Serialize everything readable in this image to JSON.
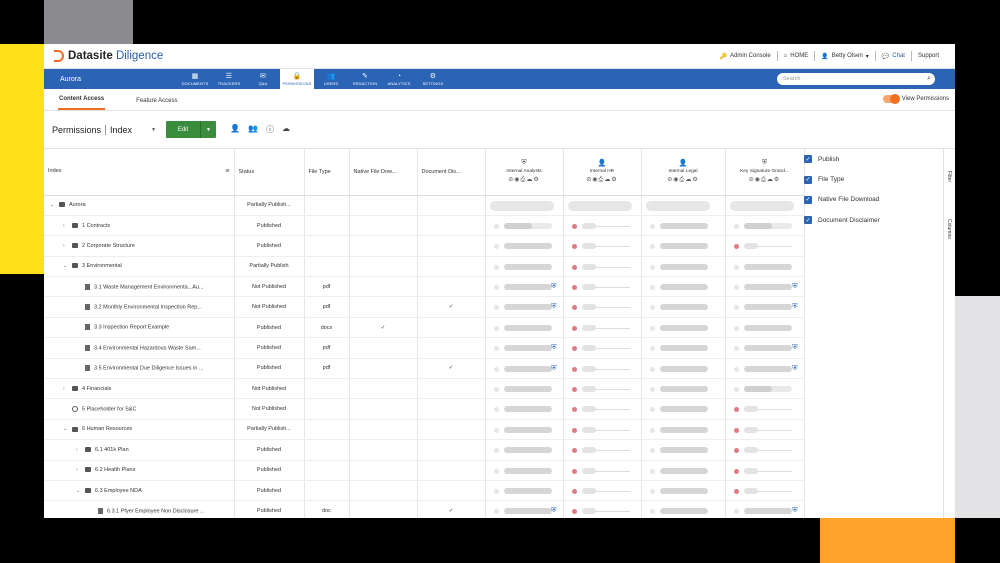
{
  "colors": {
    "brand_orange": "#f26e21",
    "nav_blue": "#2b63b5",
    "edit_green": "#3b8d3e",
    "deny_red": "#e07a83"
  },
  "header": {
    "logo_strong": "Datasite",
    "logo_light": " Diligence",
    "links": {
      "admin": "Admin Console",
      "home": "HOME",
      "user": "Betty Olsen",
      "chat": "Chat",
      "support": "Support"
    }
  },
  "nav": {
    "project": "Aurora",
    "items": [
      {
        "icon": "▦",
        "label": "DOCUMENTS"
      },
      {
        "icon": "☰",
        "label": "TRACKERS"
      },
      {
        "icon": "✉",
        "label": "Q&A"
      },
      {
        "icon": "🔒",
        "label": "PERMISSIONS"
      },
      {
        "icon": "👥",
        "label": "USERS"
      },
      {
        "icon": "✎",
        "label": "REDACTION"
      },
      {
        "icon": "◔",
        "label": "ANALYTICS"
      },
      {
        "icon": "⚙",
        "label": "SETTINGS"
      }
    ],
    "search_placeholder": "Search"
  },
  "subtabs": {
    "content_access": "Content Access",
    "feature_access": "Feature Access",
    "view_permissions": "View Permissions"
  },
  "toolbar": {
    "title": "Permissions",
    "select_value": "Index",
    "edit_label": "Edit"
  },
  "columns": {
    "index": "Index",
    "status": "Status",
    "file_type": "File Type",
    "native_download": "Native File Dow...",
    "doc_disclaimer": "Document Dis...",
    "groups": [
      {
        "icon": "⛨",
        "name": "Internal Analysts",
        "perms": "⊘◉⎙☁⚙"
      },
      {
        "icon": "👤",
        "name": "Internal HR",
        "perms": "⊘◉⎙☁⚙"
      },
      {
        "icon": "👤",
        "name": "Internal Legal",
        "perms": "⊘◉⎙☁⚙"
      },
      {
        "icon": "⛨",
        "name": "Key Signature Grand...",
        "perms": "⊘◉⎙☁⚙"
      }
    ]
  },
  "rows": [
    {
      "indent": 0,
      "toggle": "⌄",
      "kind": "folder",
      "name": "Aurora",
      "status": "Partially Publish...",
      "type": "",
      "native": "",
      "disc": "",
      "perms": [
        "sel",
        "sel_red",
        "sel",
        "sel"
      ],
      "shield": [
        false,
        false,
        false,
        false
      ]
    },
    {
      "indent": 1,
      "toggle": "›",
      "kind": "folder",
      "name": "1 Contracts",
      "status": "Published",
      "type": "",
      "native": "",
      "disc": "",
      "perms": [
        "part",
        "red_line",
        "full",
        "part"
      ],
      "shield": [
        false,
        false,
        false,
        false
      ]
    },
    {
      "indent": 1,
      "toggle": "›",
      "kind": "folder",
      "name": "2 Corporate Structure",
      "status": "Published",
      "type": "",
      "native": "",
      "disc": "",
      "perms": [
        "full",
        "red_line",
        "full",
        "red_line"
      ],
      "shield": [
        false,
        false,
        false,
        false
      ]
    },
    {
      "indent": 1,
      "toggle": "⌄",
      "kind": "folder",
      "name": "3 Environmental",
      "status": "Partially Publish",
      "type": "",
      "native": "",
      "disc": "",
      "perms": [
        "full",
        "red_line",
        "full",
        "full"
      ],
      "shield": [
        false,
        false,
        false,
        false
      ]
    },
    {
      "indent": 2,
      "toggle": "",
      "kind": "doc",
      "name": "3.1 Waste Management Environmenta...Au...",
      "status": "Not Published",
      "type": "pdf",
      "native": "",
      "disc": "",
      "perms": [
        "full",
        "red_line",
        "full",
        "full"
      ],
      "shield": [
        true,
        false,
        false,
        true
      ]
    },
    {
      "indent": 2,
      "toggle": "",
      "kind": "doc",
      "name": "3.2 Monthly Environmental Inspection Rep...",
      "status": "Not Published",
      "type": "pdf",
      "native": "",
      "disc": "✓",
      "perms": [
        "full",
        "red_line",
        "full",
        "full"
      ],
      "shield": [
        true,
        false,
        false,
        true
      ]
    },
    {
      "indent": 2,
      "toggle": "",
      "kind": "doc",
      "name": "3.3 Inspection Report Example",
      "status": "Published",
      "type": "docx",
      "native": "✓",
      "disc": "",
      "perms": [
        "full",
        "red_line",
        "full",
        "full"
      ],
      "shield": [
        false,
        false,
        false,
        false
      ]
    },
    {
      "indent": 2,
      "toggle": "",
      "kind": "doc",
      "name": "3.4 Environmental Hazardous Waste Sam...",
      "status": "Published",
      "type": "pdf",
      "native": "",
      "disc": "",
      "perms": [
        "full",
        "red_line",
        "full",
        "full"
      ],
      "shield": [
        true,
        false,
        false,
        true
      ]
    },
    {
      "indent": 2,
      "toggle": "",
      "kind": "doc",
      "name": "3.5 Environmental Due Diligence Issues in ...",
      "status": "Published",
      "type": "pdf",
      "native": "",
      "disc": "✓",
      "perms": [
        "full",
        "red_line",
        "full",
        "full"
      ],
      "shield": [
        true,
        false,
        false,
        true
      ]
    },
    {
      "indent": 1,
      "toggle": "›",
      "kind": "folder",
      "name": "4 Financials",
      "status": "Not Published",
      "type": "",
      "native": "",
      "disc": "",
      "perms": [
        "full",
        "red_line",
        "full",
        "part"
      ],
      "shield": [
        false,
        false,
        false,
        false
      ]
    },
    {
      "indent": 1,
      "toggle": "",
      "kind": "placeholder",
      "name": "5 Placeholder for S&C",
      "status": "Not Published",
      "type": "",
      "native": "",
      "disc": "",
      "perms": [
        "full",
        "red_line",
        "full",
        "red_line"
      ],
      "shield": [
        false,
        false,
        false,
        false
      ]
    },
    {
      "indent": 1,
      "toggle": "⌄",
      "kind": "folder",
      "name": "6 Human Resources",
      "status": "Partially Publish...",
      "type": "",
      "native": "",
      "disc": "",
      "perms": [
        "full",
        "red_line",
        "full",
        "red_line"
      ],
      "shield": [
        false,
        false,
        false,
        false
      ]
    },
    {
      "indent": 2,
      "toggle": "›",
      "kind": "folder",
      "name": "6.1 401k Plan",
      "status": "Published",
      "type": "",
      "native": "",
      "disc": "",
      "perms": [
        "full",
        "red_line",
        "full",
        "red_line"
      ],
      "shield": [
        false,
        false,
        false,
        false
      ]
    },
    {
      "indent": 2,
      "toggle": "›",
      "kind": "folder",
      "name": "6.2 Health Plans",
      "status": "Published",
      "type": "",
      "native": "",
      "disc": "",
      "perms": [
        "full",
        "red_line",
        "full",
        "red_line"
      ],
      "shield": [
        false,
        false,
        false,
        false
      ]
    },
    {
      "indent": 2,
      "toggle": "⌄",
      "kind": "folder",
      "name": "6.3 Employee NDA",
      "status": "Published",
      "type": "",
      "native": "",
      "disc": "",
      "perms": [
        "full",
        "red_line",
        "full",
        "red_line"
      ],
      "shield": [
        false,
        false,
        false,
        false
      ]
    },
    {
      "indent": 3,
      "toggle": "",
      "kind": "doc",
      "name": "6.3.1 Pfyer Employee Non Disclosure ...",
      "status": "Published",
      "type": "doc",
      "native": "",
      "disc": "✓",
      "perms": [
        "full",
        "red_line",
        "full",
        "full"
      ],
      "shield": [
        true,
        false,
        false,
        true
      ]
    }
  ],
  "side_panel": {
    "items": [
      "Publish",
      "File Type",
      "Native File Download",
      "Document Disclaimer"
    ],
    "vertical_tabs": [
      "Filter",
      "Columns"
    ]
  }
}
